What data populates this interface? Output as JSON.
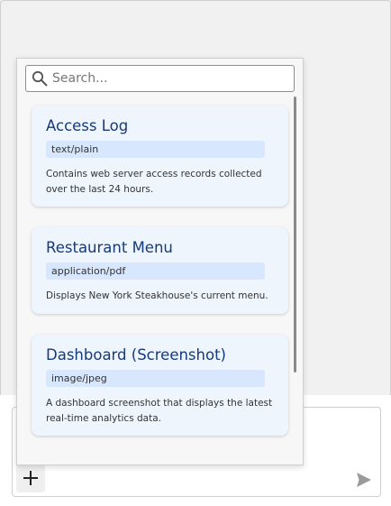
{
  "search": {
    "placeholder": "Search..."
  },
  "cards": [
    {
      "title": "Access Log",
      "mime": "text/plain",
      "description": "Contains web server access records collected over the last 24 hours."
    },
    {
      "title": "Restaurant Menu",
      "mime": "application/pdf",
      "description": "Displays New York Steakhouse's current menu."
    },
    {
      "title": "Dashboard (Screenshot)",
      "mime": "image/jpeg",
      "description": "A dashboard screenshot that displays the latest real-time analytics data."
    }
  ],
  "composer": {
    "add_icon": "plus-icon",
    "send_icon": "send-icon"
  },
  "colors": {
    "card_bg": "#eef5fd",
    "badge_bg": "#d7e7fd",
    "title": "#163a7a"
  }
}
